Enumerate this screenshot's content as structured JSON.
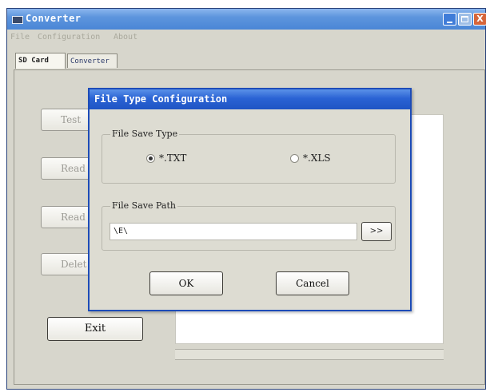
{
  "window": {
    "title": "Converter",
    "buttons": {
      "minimize": "",
      "maximize": "",
      "close": "X"
    },
    "menu": [
      "File",
      "Configuration",
      "About"
    ]
  },
  "tabs": [
    {
      "label": "SD Card",
      "active": true
    },
    {
      "label": "Converter",
      "active": false
    }
  ],
  "side_buttons": [
    "Test",
    "Read",
    "Read",
    "Delet"
  ],
  "exit_label": "Exit",
  "dialog": {
    "title": "File Type Configuration",
    "save_type": {
      "legend": "File Save Type",
      "options": [
        {
          "label": "*.TXT",
          "selected": true
        },
        {
          "label": "*.XLS",
          "selected": false
        }
      ]
    },
    "save_path": {
      "legend": "File Save Path",
      "value": "\\E\\",
      "browse_label": ">>"
    },
    "ok_label": "OK",
    "cancel_label": "Cancel"
  }
}
